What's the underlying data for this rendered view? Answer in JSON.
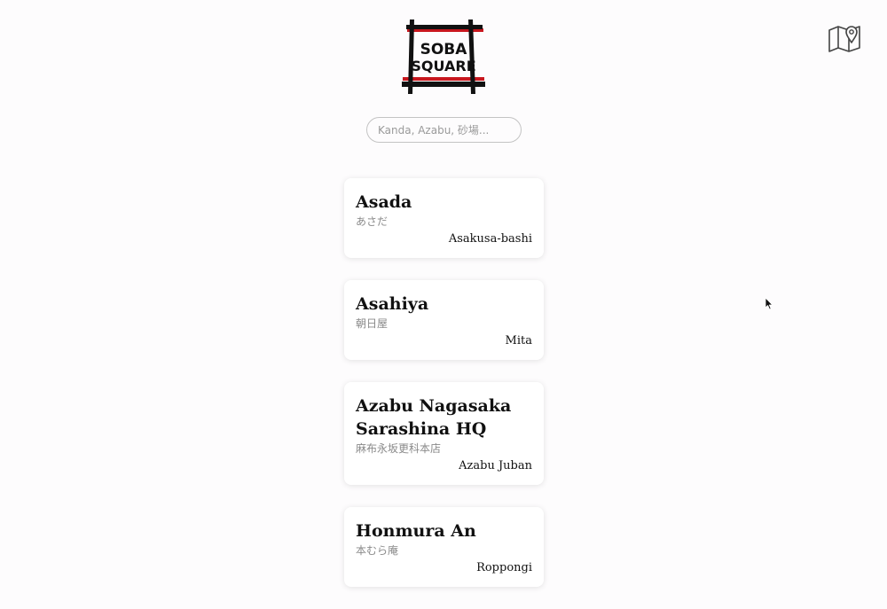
{
  "logo": {
    "line1": "SOBA",
    "line2": "SQUARE",
    "colors": {
      "frame": "#111111",
      "accent": "#c8171e"
    }
  },
  "header": {
    "map_icon": "map-pin-icon"
  },
  "search": {
    "placeholder": "Kanda, Azabu, 砂場...",
    "value": ""
  },
  "restaurants": [
    {
      "name": "Asada",
      "name_jp": "あさだ",
      "area": "Asakusa-bashi"
    },
    {
      "name": "Asahiya",
      "name_jp": "朝日屋",
      "area": "Mita"
    },
    {
      "name": "Azabu Nagasaka Sarashina HQ",
      "name_jp": "麻布永坂更科本店",
      "area": "Azabu Juban"
    },
    {
      "name": "Honmura An",
      "name_jp": "本むら庵",
      "area": "Roppongi"
    }
  ]
}
